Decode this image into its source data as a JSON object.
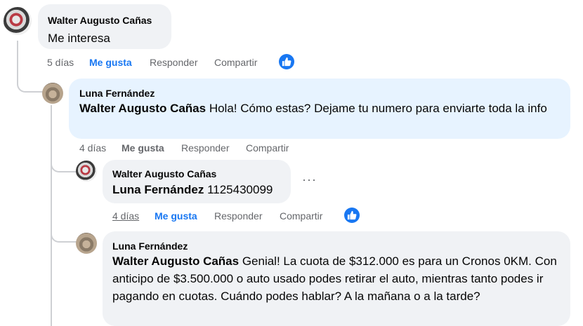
{
  "comments": [
    {
      "author": "Walter Augusto Cañas",
      "text": "Me interesa",
      "time": "5 días",
      "like": "Me gusta",
      "reply": "Responder",
      "share": "Compartir"
    },
    {
      "author": "Luna Fernández",
      "mention": "Walter Augusto Cañas",
      "text": " Hola! Cómo estas? Dejame tu numero para enviarte toda la info",
      "time": "4 días",
      "like": "Me gusta",
      "reply": "Responder",
      "share": "Compartir"
    },
    {
      "author": "Walter Augusto Cañas",
      "mention": "Luna Fernández",
      "text": " 1125430099",
      "more": "···",
      "time": "4 días",
      "like": "Me gusta",
      "reply": "Responder",
      "share": "Compartir"
    },
    {
      "author": "Luna Fernández",
      "mention": "Walter Augusto Cañas",
      "text": " Genial! La cuota de $312.000 es para un Cronos 0KM. Con anticipo de $3.500.000 o auto usado podes retirar el auto, mientras tanto podes ir pagando en cuotas. Cuándo podes hablar? A la mañana o a la tarde?"
    }
  ],
  "colors": {
    "accent": "#1877f2",
    "bubble": "#f0f2f5",
    "highlight": "#e7f3ff",
    "meta": "#65676b"
  },
  "icons": {
    "reaction": "thumbs-up-icon"
  }
}
